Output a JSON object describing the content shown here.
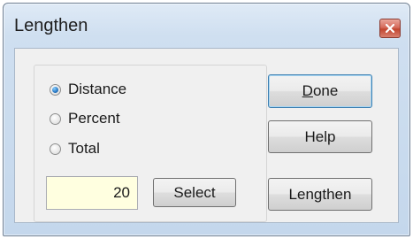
{
  "window": {
    "title": "Lengthen"
  },
  "title_bar": {
    "close_icon": "close-icon"
  },
  "mode": {
    "options": [
      {
        "label": "Distance",
        "selected": true
      },
      {
        "label": "Percent",
        "selected": false
      },
      {
        "label": "Total",
        "selected": false
      }
    ]
  },
  "value_field": {
    "value": "20"
  },
  "buttons": {
    "select": "Select",
    "done_mnemonic": "D",
    "done_rest": "one",
    "help": "Help",
    "lengthen": "Lengthen"
  },
  "colors": {
    "input_background": "#ffffe0",
    "radio_selected": "#2f7fc9",
    "close_button": "#c2452f"
  }
}
